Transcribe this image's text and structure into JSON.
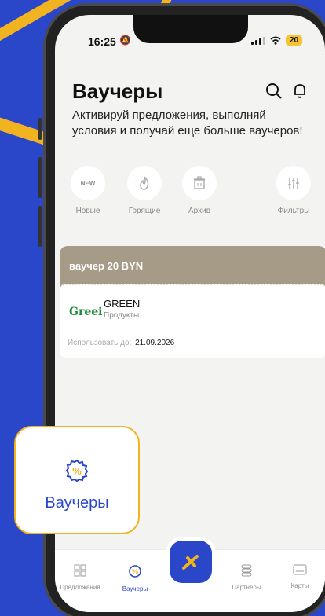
{
  "status": {
    "time": "16:25",
    "battery": "20"
  },
  "header": {
    "title": "Ваучеры",
    "subtitle": "Активируй предложения, выполняй условия и получай еще больше ваучеров!"
  },
  "filters": [
    {
      "label": "Новые",
      "icon": "new-icon",
      "badge": "NEW"
    },
    {
      "label": "Горящие",
      "icon": "fire-icon"
    },
    {
      "label": "Архив",
      "icon": "archive-icon"
    },
    {
      "label": "Фильтры",
      "icon": "sliders-icon"
    }
  ],
  "voucher": {
    "title": "ваучер 20 BYN",
    "partner": "GREEN",
    "logo_text": "Greei",
    "category": "Продукты",
    "valid_label": "Использовать до:",
    "valid_date": "21.09.2026"
  },
  "tabs": [
    {
      "label": "Предложения",
      "icon": "offers-icon"
    },
    {
      "label": "Ваучеры",
      "icon": "voucher-icon"
    },
    {
      "label": "Партнёры",
      "icon": "partners-icon"
    },
    {
      "label": "Карты",
      "icon": "card-icon"
    }
  ],
  "callout": {
    "label": "Ваучеры",
    "icon": "voucher-badge-icon"
  },
  "colors": {
    "accent": "#2a46c9",
    "highlight": "#f2b320",
    "voucher_band": "#a59b87"
  }
}
